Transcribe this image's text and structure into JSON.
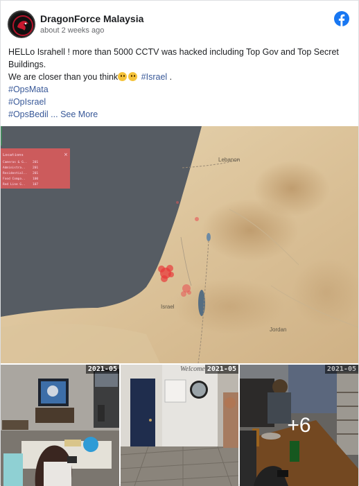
{
  "post": {
    "author": "DragonForce Malaysia",
    "timestamp": "about 2 weeks ago",
    "line1": "HELLo Israhell ! more than 5000 CCTV was hacked including Top Gov and Top Secret Buildings.",
    "line2_text": "We are closer than you think",
    "line2_tag": "#Israel",
    "line2_end": " .",
    "tags": [
      "#OpsMata",
      "#OpIsrael",
      "#OpsBedil"
    ],
    "see_more": "... See More"
  },
  "map": {
    "labels": {
      "lebanon": "Lebanon",
      "israel": "Israel",
      "jordan": "Jordan"
    },
    "panel_title": "Locations",
    "panel_rows": [
      {
        "name": "Cameras & G..",
        "count": "201"
      },
      {
        "name": "Administra..",
        "count": "201"
      },
      {
        "name": "Residential..",
        "count": "201"
      },
      {
        "name": "Food Compa..",
        "count": "100"
      },
      {
        "name": "Red Line G..",
        "count": "107"
      }
    ],
    "panel_close": "×"
  },
  "photos": {
    "timestamps": [
      "2021-05",
      "2021-05",
      "2021-05"
    ],
    "more_count": "+6",
    "sign_text": "Welcome"
  },
  "colors": {
    "link": "#385898",
    "facebook_blue": "#1877f2",
    "hotspot": "#e83b3b"
  }
}
